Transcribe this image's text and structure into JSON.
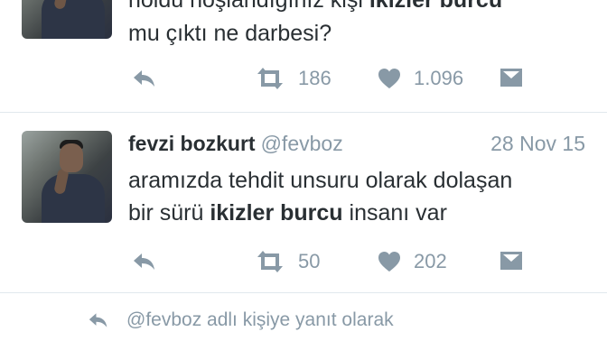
{
  "tweet1": {
    "line1_plain": "holdu hoşlandığınız kişi ",
    "line1_bold": "ikizler burcu",
    "line2": "mu çıktı ne darbesi?",
    "retweets": "186",
    "likes": "1.096"
  },
  "tweet2": {
    "name": "fevzi bozkurt",
    "handle": "@fevboz",
    "date": "28 Nov 15",
    "line1": "aramızda tehdit unsuru olarak dolaşan",
    "line2_pre": "bir sürü ",
    "line2_bold": "ikizler burcu",
    "line2_post": " insanı var",
    "retweets": "50",
    "likes": "202"
  },
  "footer": {
    "reply_context": "@fevboz adlı kişiye yanıt olarak"
  },
  "colors": {
    "text": "#292f33",
    "muted": "#8899a6",
    "divider": "#e1e8ed"
  },
  "icons": [
    "reply-icon",
    "retweet-icon",
    "heart-icon",
    "direct-message-icon"
  ]
}
